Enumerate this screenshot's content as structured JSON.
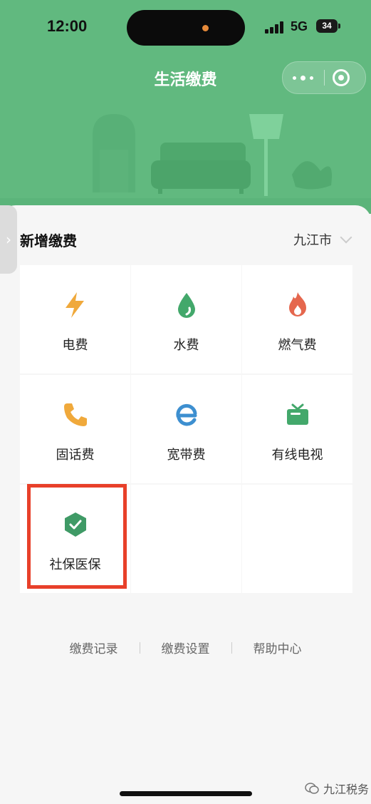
{
  "status_bar": {
    "time": "12:00",
    "network": "5G",
    "battery": "34"
  },
  "nav": {
    "title": "生活缴费"
  },
  "section": {
    "title": "新增缴费",
    "city": "九江市"
  },
  "bill_types": [
    {
      "label": "电费",
      "icon": "lightning-icon",
      "color": "#f0a93b"
    },
    {
      "label": "水费",
      "icon": "water-drop-icon",
      "color": "#43a86b"
    },
    {
      "label": "燃气费",
      "icon": "flame-icon",
      "color": "#e5674e"
    },
    {
      "label": "固话费",
      "icon": "phone-icon",
      "color": "#f0a93b"
    },
    {
      "label": "宽带费",
      "icon": "broadband-e-icon",
      "color": "#3d8fd0"
    },
    {
      "label": "有线电视",
      "icon": "tv-icon",
      "color": "#43a86b"
    },
    {
      "label": "社保医保",
      "icon": "shield-check-icon",
      "color": "#3f9a66"
    }
  ],
  "footer": {
    "records": "缴费记录",
    "settings": "缴费设置",
    "help": "帮助中心"
  },
  "watermark": {
    "text": "九江税务"
  },
  "colors": {
    "header_green": "#61b97f",
    "highlight_red": "#e8402a"
  }
}
